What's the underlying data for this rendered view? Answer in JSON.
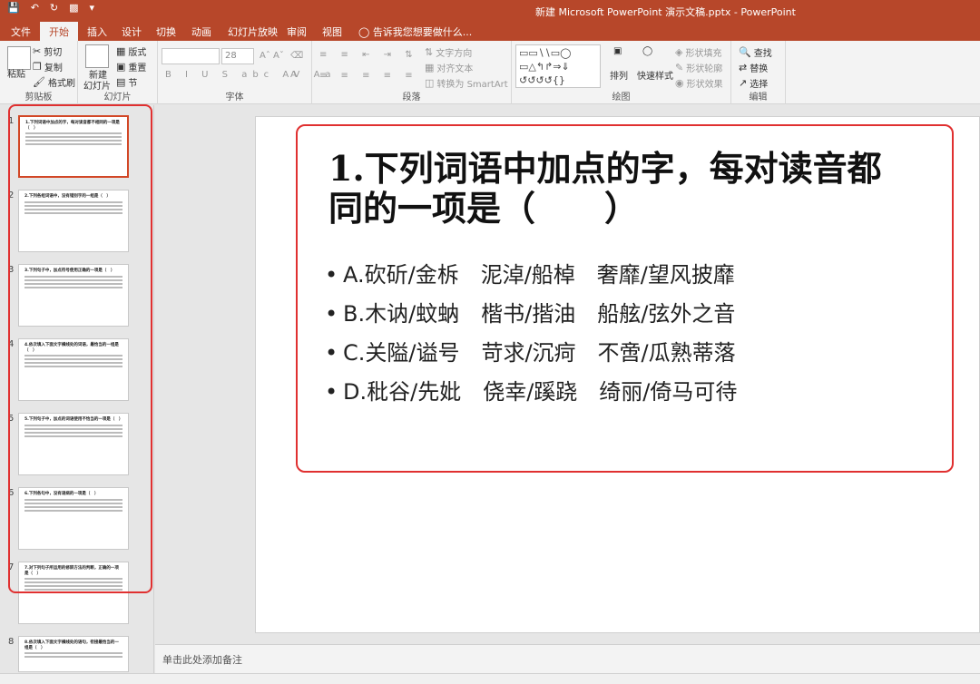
{
  "window": {
    "title": "新建 Microsoft PowerPoint 演示文稿.pptx - PowerPoint",
    "quick_access": [
      "save-icon",
      "undo-icon",
      "redo-icon",
      "present-icon",
      "customize-icon"
    ]
  },
  "tabs": [
    "文件",
    "开始",
    "插入",
    "设计",
    "切换",
    "动画",
    "幻灯片放映",
    "审阅",
    "视图"
  ],
  "active_tab": "开始",
  "tell_me": "告诉我您想要做什么...",
  "ribbon": {
    "clipboard": {
      "label": "剪贴板",
      "paste": "粘贴",
      "cut": "剪切",
      "copy": "复制",
      "format_painter": "格式刷"
    },
    "slides": {
      "label": "幻灯片",
      "new_slide": "新建",
      "new_slide2": "幻灯片",
      "layout": "版式",
      "reset": "重置",
      "section": "节"
    },
    "font": {
      "label": "字体",
      "size": "28"
    },
    "paragraph": {
      "label": "段落",
      "text_direction": "文字方向",
      "align_text": "对齐文本",
      "smartart": "转换为 SmartArt"
    },
    "drawing": {
      "label": "绘图",
      "arrange": "排列",
      "quick_styles": "快速样式",
      "shape_fill": "形状填充",
      "shape_outline": "形状轮廓",
      "shape_effects": "形状效果"
    },
    "editing": {
      "label": "编辑",
      "find": "查找",
      "replace": "替换",
      "select": "选择"
    }
  },
  "thumbnails": [
    {
      "num": "1",
      "title": "1.下列词语中加点的字，每对读音都不相同的一项是（　）"
    },
    {
      "num": "2",
      "title": "2.下列各组词语中，没有错别字的一组是（　）"
    },
    {
      "num": "3",
      "title": "3.下列句子中，加点符号使用正确的一项是（　）"
    },
    {
      "num": "4",
      "title": "4.依次填入下面文字横线处的词语，最恰当的一组是（　）"
    },
    {
      "num": "5",
      "title": "5.下列句子中，加点的词语使用不恰当的一项是（　）"
    },
    {
      "num": "6",
      "title": "6.下列各句中，没有语病的一项是（　）"
    },
    {
      "num": "7",
      "title": "7.对下列句子所运用的修辞方法的判断，正确的一项是（　）"
    },
    {
      "num": "8",
      "title": "8.依次填入下面文字横线处的语句，衔接最恰当的一组是（　）"
    }
  ],
  "slide": {
    "title_line1": "1.下列词语中加点的字，每对读音都",
    "title_line2": "同的一项是（　　）",
    "options": [
      "A.砍斫/金柝　泥淖/船棹　奢靡/望风披靡",
      "B.木讷/蚊蚋　楷书/揩油　船舷/弦外之音",
      "C.关隘/谥号　苛求/沉疴　不啻/瓜熟蒂落",
      "D.秕谷/先妣　侥幸/蹊跷　绮丽/倚马可待"
    ]
  },
  "notes_placeholder": "单击此处添加备注",
  "colors": {
    "accent": "#b7472a",
    "highlight": "#e03030"
  }
}
